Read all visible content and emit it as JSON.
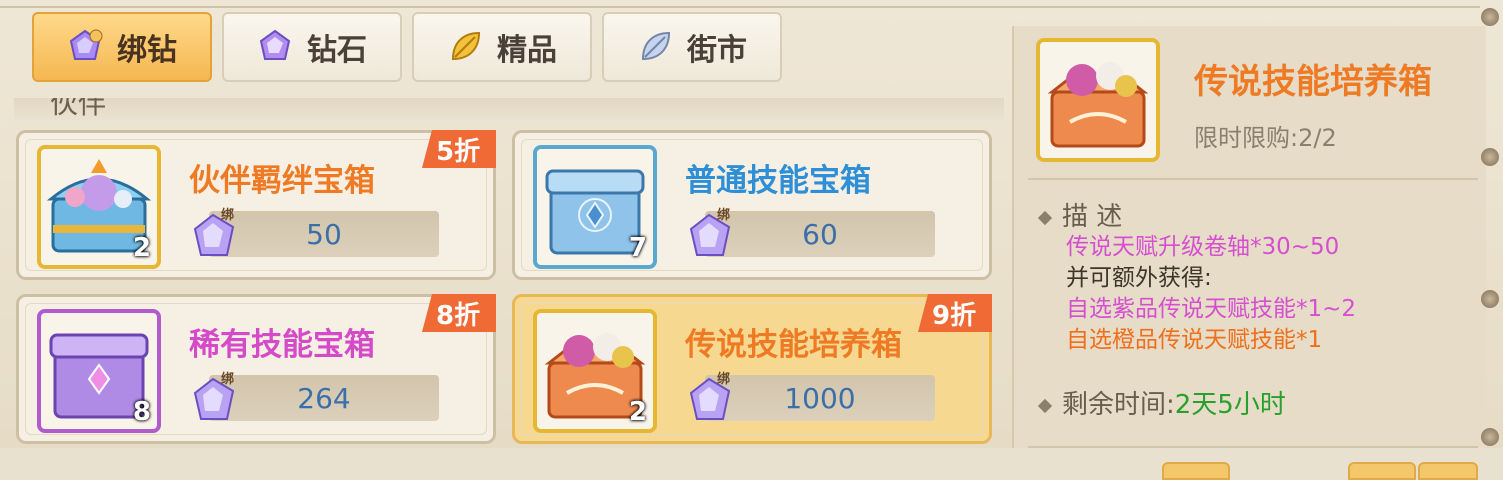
{
  "tabs": [
    {
      "label": "绑钻",
      "icon": "bound-diamond-icon",
      "active": true
    },
    {
      "label": "钻石",
      "icon": "diamond-icon",
      "active": false
    },
    {
      "label": "精品",
      "icon": "gold-leaf-icon",
      "active": false
    },
    {
      "label": "街市",
      "icon": "silver-leaf-icon",
      "active": false
    }
  ],
  "section_label": "伙伴",
  "currency_tag": "绑",
  "items": [
    {
      "name": "伙伴羁绊宝箱",
      "price": "50",
      "count": "2",
      "discount": "5折",
      "name_color": "#ef7a24"
    },
    {
      "name": "普通技能宝箱",
      "price": "60",
      "count": "7",
      "discount": "",
      "name_color": "#2f8fd6"
    },
    {
      "name": "稀有技能宝箱",
      "price": "264",
      "count": "8",
      "discount": "8折",
      "name_color": "#d44ac8"
    },
    {
      "name": "传说技能培养箱",
      "price": "1000",
      "count": "2",
      "discount": "9折",
      "name_color": "#ef7a24",
      "selected": true
    }
  ],
  "detail": {
    "title": "传说技能培养箱",
    "limit": "限时限购:2/2",
    "desc_header": "描 述",
    "desc_lines": [
      {
        "text": "传说天赋升级卷轴*30~50",
        "color": "pink"
      },
      {
        "text": "并可额外获得:",
        "color": "dark"
      },
      {
        "text": "自选紫品传说天赋技能*1~2",
        "color": "pink"
      },
      {
        "text": "自选橙品传说天赋技能*1",
        "color": "orange"
      }
    ],
    "remain_label": "剩余时间:",
    "remain_value": "2天5小时"
  },
  "colors": {
    "accent": "#f5b750",
    "discount": "#ef6a35",
    "price": "#3b6fa8",
    "time": "#29a02d"
  }
}
